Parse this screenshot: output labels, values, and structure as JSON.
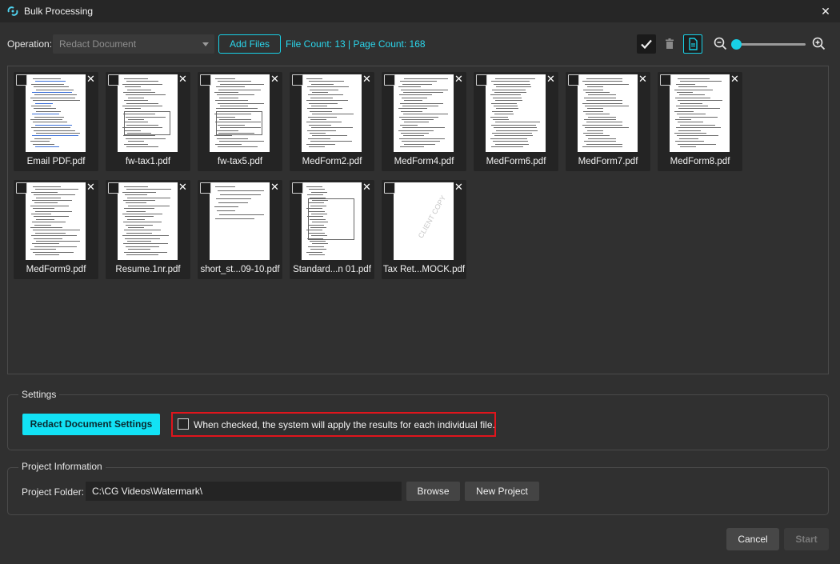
{
  "window": {
    "title": "Bulk Processing",
    "close": "✕"
  },
  "toolbar": {
    "operation_label": "Operation:",
    "operation_value": "Redact Document",
    "add_files_label": "Add Files",
    "count_text": "File Count: 13 | Page Count: 168",
    "zoom_level": 0.02
  },
  "files": [
    {
      "name": "Email PDF.pdf",
      "style": "email"
    },
    {
      "name": "fw-tax1.pdf",
      "style": "form"
    },
    {
      "name": "fw-tax5.pdf",
      "style": "form"
    },
    {
      "name": "MedForm2.pdf",
      "style": "text"
    },
    {
      "name": "MedForm4.pdf",
      "style": "text"
    },
    {
      "name": "MedForm6.pdf",
      "style": "text"
    },
    {
      "name": "MedForm7.pdf",
      "style": "text"
    },
    {
      "name": "MedForm8.pdf",
      "style": "text"
    },
    {
      "name": "MedForm9.pdf",
      "style": "text"
    },
    {
      "name": "Resume.1nr.pdf",
      "style": "resume"
    },
    {
      "name": "short_st...09-10.pdf",
      "style": "short"
    },
    {
      "name": "Standard...n 01.pdf",
      "style": "standard"
    },
    {
      "name": "Tax Ret...MOCK.pdf",
      "style": "mock",
      "watermark": "CLIENT COPY"
    }
  ],
  "settings": {
    "legend": "Settings",
    "redact_button": "Redact Document Settings",
    "apply_checkbox_label": "When checked, the system will apply the results for each individual file."
  },
  "project": {
    "legend": "Project Information",
    "folder_label": "Project Folder:",
    "folder_value": "C:\\CG Videos\\Watermark\\",
    "browse": "Browse",
    "new_project": "New Project"
  },
  "footer": {
    "cancel": "Cancel",
    "start": "Start"
  },
  "colors": {
    "accent": "#18d0e6",
    "highlight": "#e0151c",
    "background": "#303030"
  }
}
